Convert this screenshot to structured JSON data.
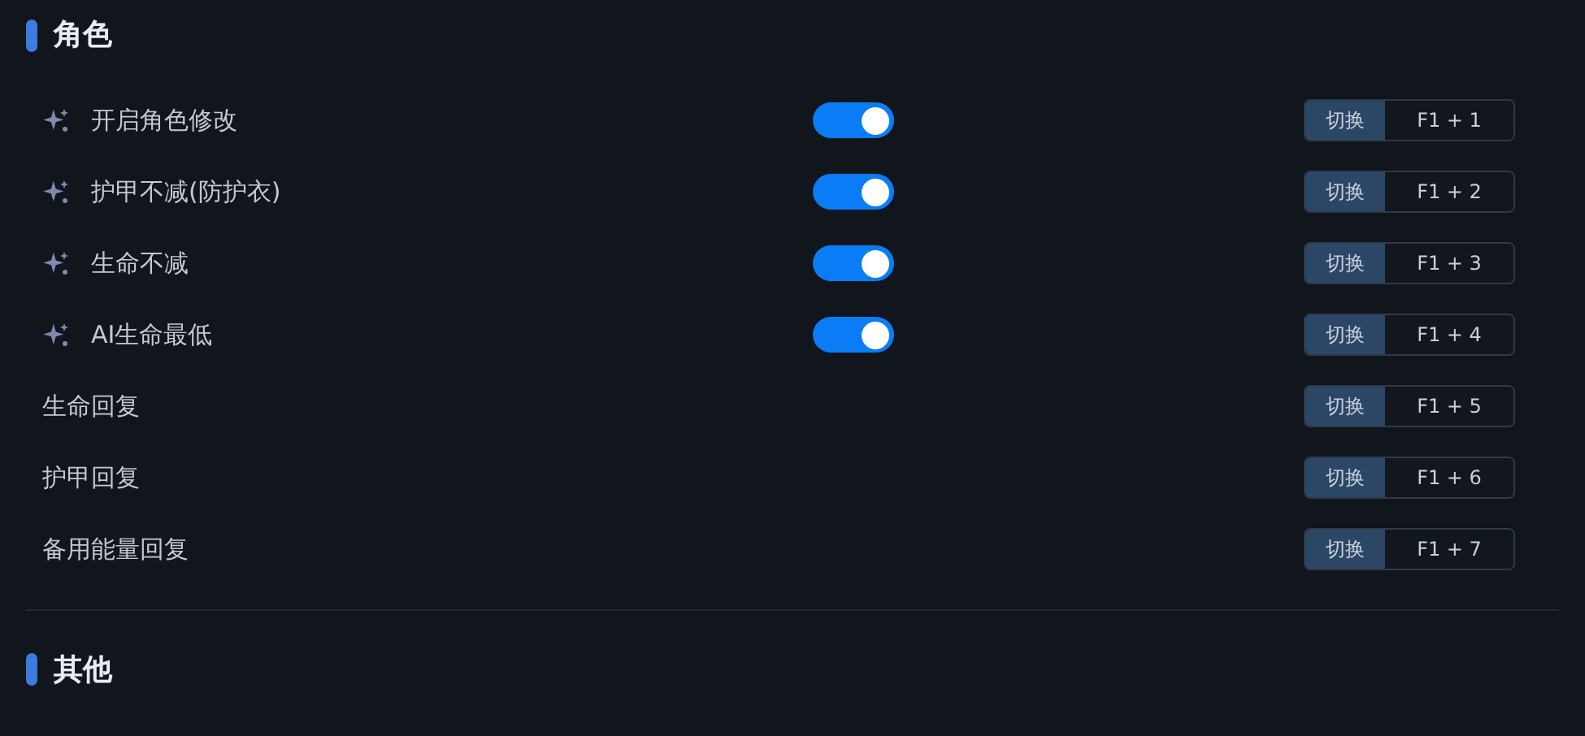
{
  "sections": [
    {
      "title": "角色",
      "rows": [
        {
          "kind": "switch",
          "label": "开启角色修改",
          "on": true,
          "hotkey_label": "切换",
          "hotkey": "F1 + 1"
        },
        {
          "kind": "switch",
          "label": "护甲不减(防护衣)",
          "on": true,
          "hotkey_label": "切换",
          "hotkey": "F1 + 2"
        },
        {
          "kind": "switch",
          "label": "生命不减",
          "on": true,
          "hotkey_label": "切换",
          "hotkey": "F1 + 3"
        },
        {
          "kind": "switch",
          "label": "AI生命最低",
          "on": true,
          "hotkey_label": "切换",
          "hotkey": "F1 + 4"
        },
        {
          "kind": "plain",
          "label": "生命回复",
          "hotkey_label": "切换",
          "hotkey": "F1 + 5"
        },
        {
          "kind": "plain",
          "label": "护甲回复",
          "hotkey_label": "切换",
          "hotkey": "F1 + 6"
        },
        {
          "kind": "plain",
          "label": "备用能量回复",
          "hotkey_label": "切换",
          "hotkey": "F1 + 7"
        }
      ]
    },
    {
      "title": "其他"
    }
  ]
}
